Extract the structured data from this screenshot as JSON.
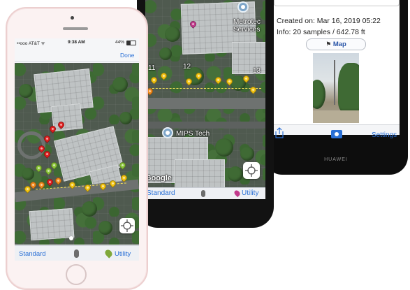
{
  "phone_white": {
    "status_bar": {
      "carrier": "••ooo AT&T ᯤ",
      "time": "9:38 AM",
      "battery": "44%"
    },
    "nav": {
      "done_label": "Done"
    },
    "tabbar": {
      "standard_label": "Standard",
      "utility_label": "Utility"
    }
  },
  "phone_black": {
    "poi_top": "Metrotec\nServices",
    "poi_bottom": "MIPS Tech",
    "map_badge": "Google",
    "track_labels": [
      "11",
      "12",
      "13"
    ],
    "tabbar": {
      "standard_label": "Standard",
      "utility_label": "Utility"
    }
  },
  "phone_huawei": {
    "created_text": "Created on: Mar 16, 2019 05:22",
    "info_text": "Info: 20 samples / 642.78 ft",
    "map_button_label": "Map",
    "toolbar": {
      "settings_label": "Settings"
    },
    "brand": "HUAWEI"
  },
  "colors": {
    "accent": "#2a70d6",
    "pin_yellow": "#f2c312",
    "pin_orange": "#f08a1c",
    "pin_red": "#e02020",
    "pin_green": "#8bc53a"
  }
}
